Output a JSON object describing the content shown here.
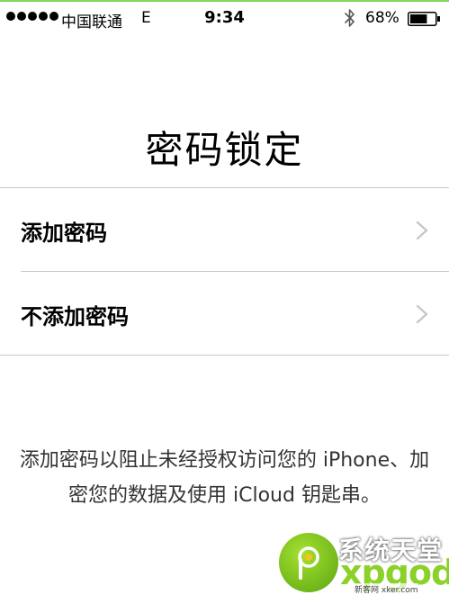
{
  "status_bar": {
    "carrier": "中国联通",
    "network": "E",
    "time": "9:34",
    "battery_percent": "68%",
    "battery_level": 0.68,
    "icons": [
      "signal-dots-icon",
      "bluetooth-icon",
      "battery-icon"
    ]
  },
  "title": "密码锁定",
  "options": [
    {
      "label": "添加密码"
    },
    {
      "label": "不添加密码"
    }
  ],
  "description": "添加密码以阻止未经授权访问您的 iPhone、加密您的数据及使用 iCloud 钥匙串。",
  "watermark": {
    "title": "系统天堂",
    "word": "xpgod",
    "sub": "新客网 xker.com"
  },
  "colors": {
    "separator": "#c8c7cc",
    "chevron": "#c7c7cc",
    "watermark_green": "#8bd129",
    "status_border": "#7ed957"
  }
}
